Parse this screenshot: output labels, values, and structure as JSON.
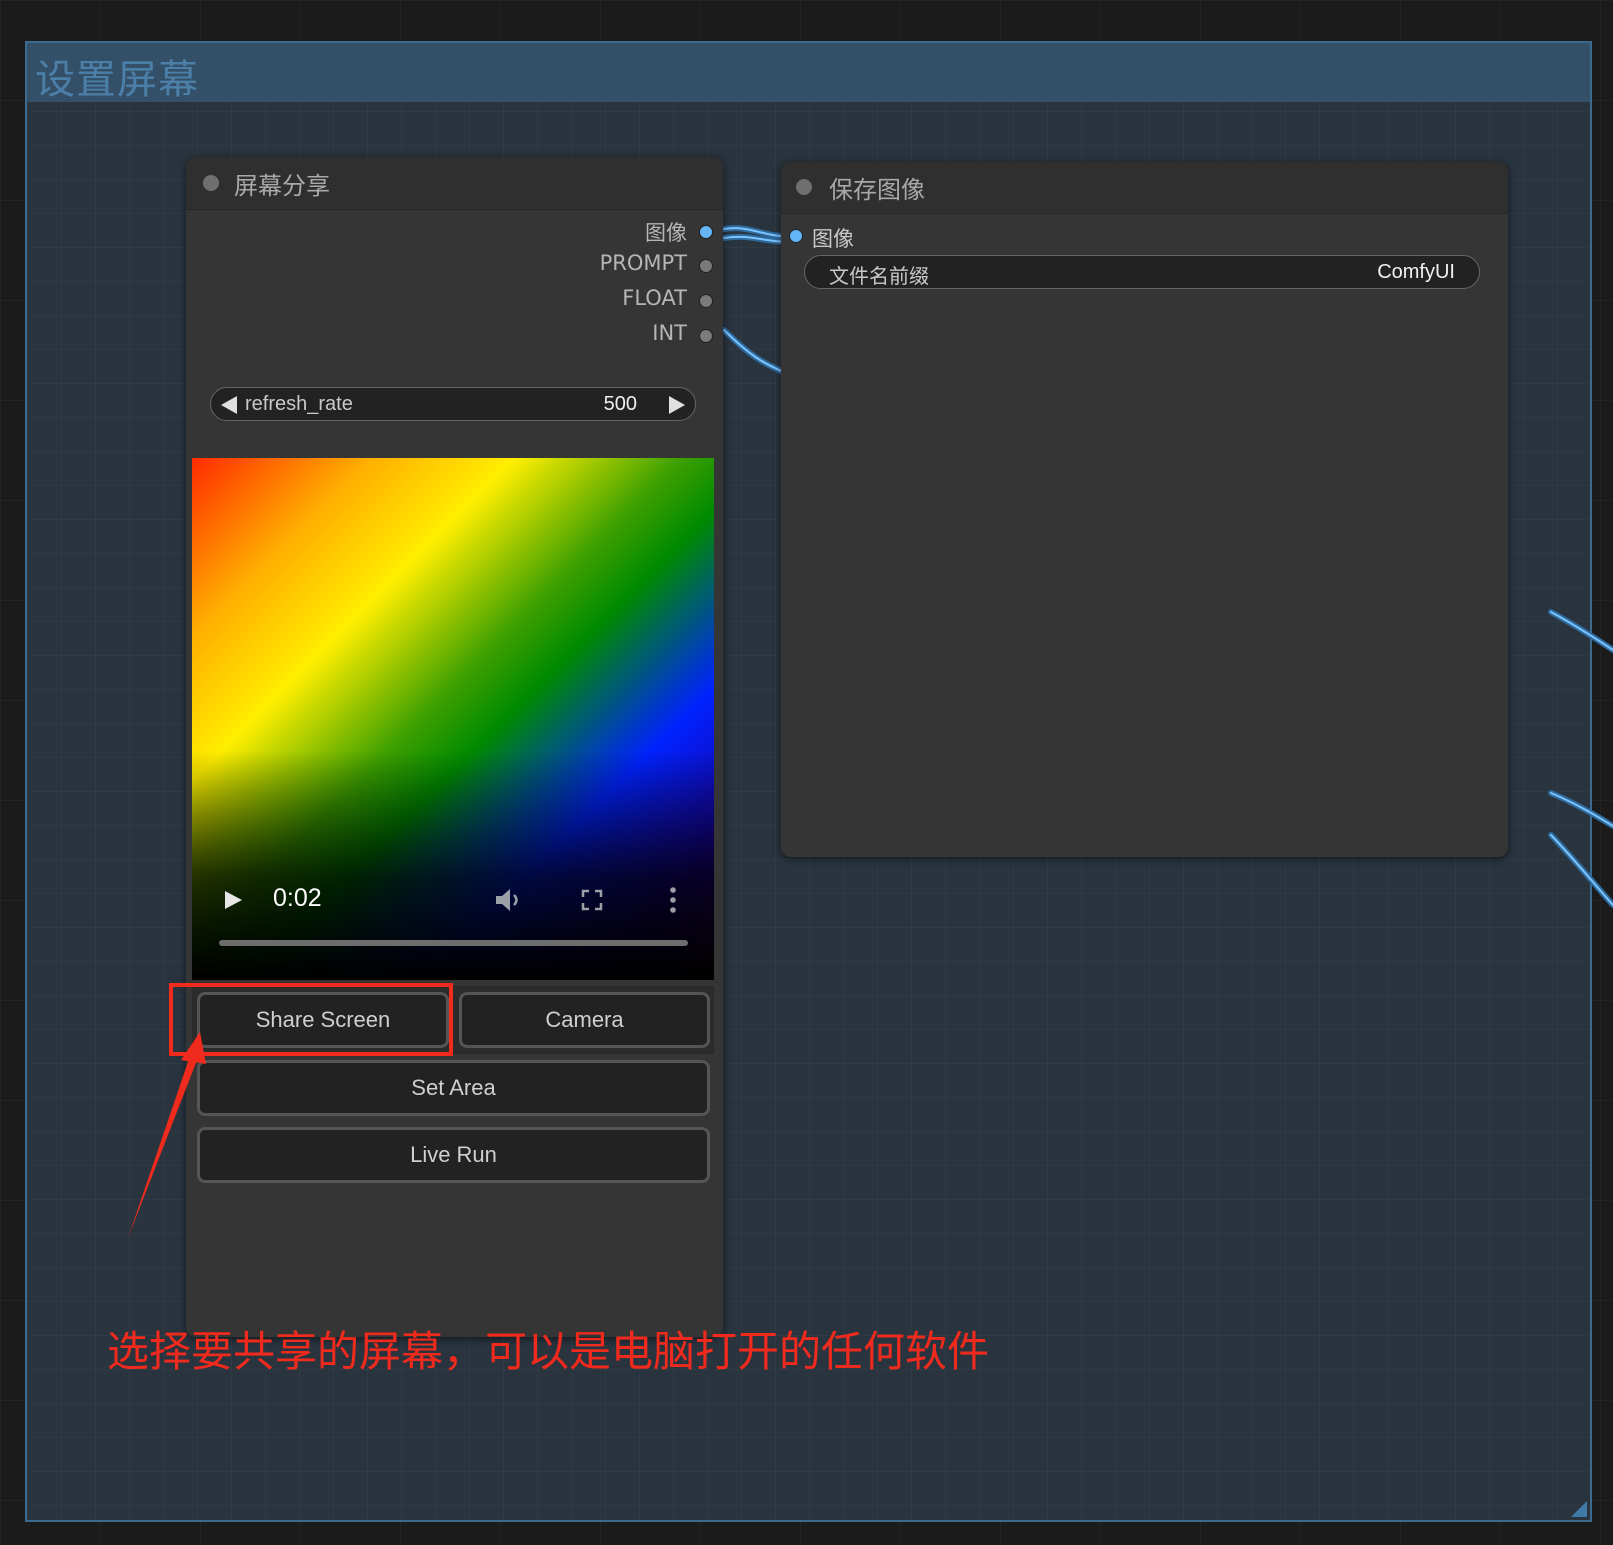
{
  "group": {
    "title": "设置屏幕"
  },
  "node_screen_share": {
    "title": "屏幕分享",
    "outputs": [
      {
        "label": "图像",
        "type": "image"
      },
      {
        "label": "PROMPT",
        "type": "prompt"
      },
      {
        "label": "FLOAT",
        "type": "float"
      },
      {
        "label": "INT",
        "type": "int"
      }
    ],
    "refresh_rate": {
      "label": "refresh_rate",
      "value": "500"
    },
    "video": {
      "time": "0:02",
      "progress": 0.0
    },
    "buttons": {
      "share_screen": "Share Screen",
      "camera": "Camera",
      "set_area": "Set Area",
      "live_run": "Live Run"
    }
  },
  "node_save_image": {
    "title": "保存图像",
    "input_label": "图像",
    "filename_prefix": {
      "label": "文件名前缀",
      "value": "ComfyUI"
    }
  },
  "annotation": {
    "text": "选择要共享的屏幕，可以是电脑打开的任何软件",
    "color": "#f02a1c"
  },
  "colors": {
    "image_link": "#64b5f6",
    "group_border": "#3a6a8e"
  },
  "icons": [
    "play-icon",
    "volume-icon",
    "fullscreen-icon",
    "more-icon",
    "arrow-left-icon",
    "arrow-right-icon"
  ]
}
